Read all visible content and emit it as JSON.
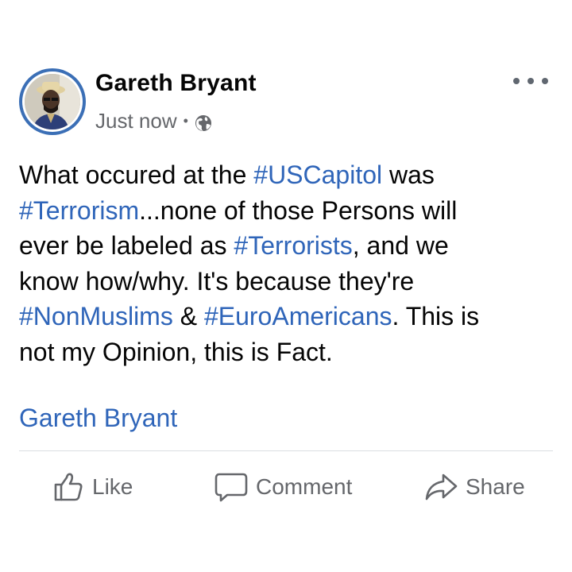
{
  "post": {
    "author": "Gareth Bryant",
    "timestamp": "Just now",
    "separator": "•",
    "audience_icon": "globe-icon",
    "menu_icon": "more-options-icon",
    "text_lines": [
      [
        {
          "t": "What occured at the ",
          "tag": false
        },
        {
          "t": "#USCapitol",
          "tag": true
        },
        {
          "t": " was",
          "tag": false
        }
      ],
      [
        {
          "t": "#Terrorism",
          "tag": true
        },
        {
          "t": "...none of those Persons will",
          "tag": false
        }
      ],
      [
        {
          "t": "ever be labeled as ",
          "tag": false
        },
        {
          "t": "#Terrorists",
          "tag": true
        },
        {
          "t": ", and we",
          "tag": false
        }
      ],
      [
        {
          "t": "know how/why. It's because they're",
          "tag": false
        }
      ],
      [
        {
          "t": "#NonMuslims",
          "tag": true
        },
        {
          "t": " & ",
          "tag": false
        },
        {
          "t": "#EuroAmericans",
          "tag": true
        },
        {
          "t": ". This is",
          "tag": false
        }
      ],
      [
        {
          "t": "not my Opinion, this is Fact.",
          "tag": false
        }
      ]
    ],
    "signature": "Gareth Bryant"
  },
  "actions": {
    "like_label": "Like",
    "comment_label": "Comment",
    "share_label": "Share"
  },
  "colors": {
    "hashtag": "#2f65b9",
    "secondary_text": "#65676b",
    "avatar_ring": "#3b6fb6"
  }
}
